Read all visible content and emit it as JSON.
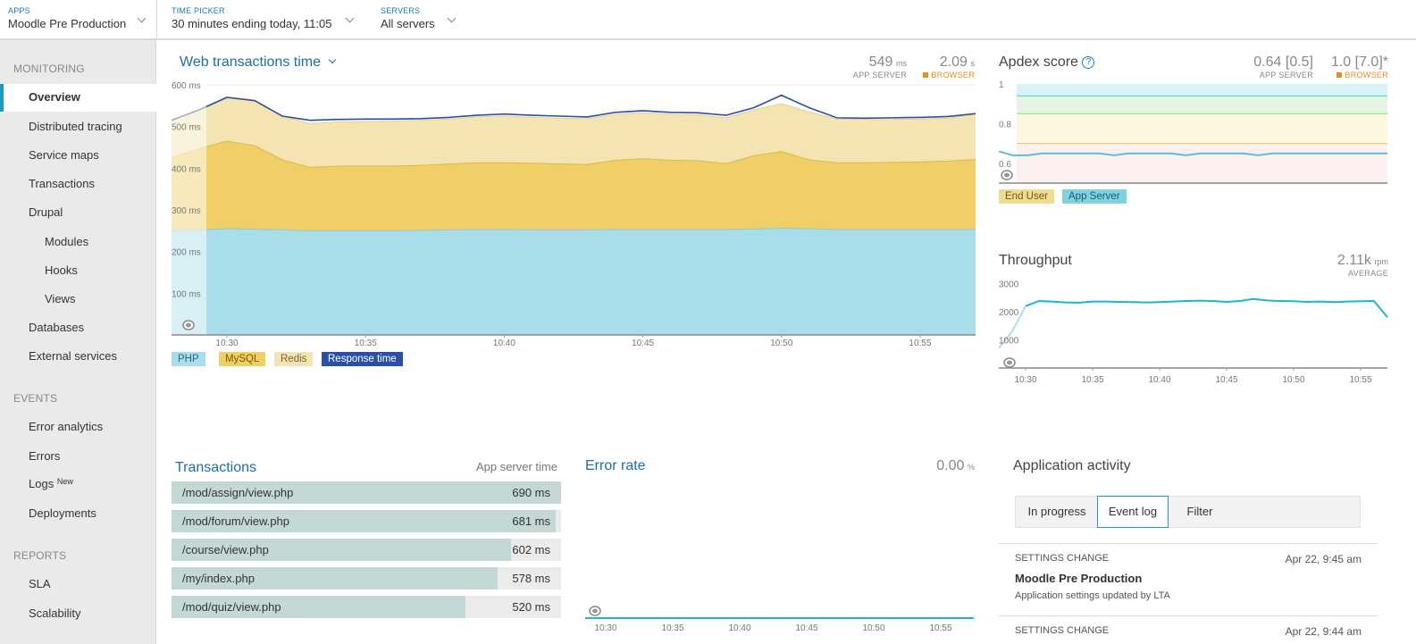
{
  "topbar": {
    "apps": {
      "label": "APPS",
      "value": "Moodle Pre Production"
    },
    "time_picker": {
      "label": "TIME PICKER",
      "value": "30 minutes ending today, 11:05"
    },
    "servers": {
      "label": "SERVERS",
      "value": "All servers"
    }
  },
  "sidebar": {
    "monitoring_header": "MONITORING",
    "overview": "Overview",
    "distributed_tracing": "Distributed tracing",
    "service_maps": "Service maps",
    "transactions": "Transactions",
    "drupal": "Drupal",
    "modules": "Modules",
    "hooks": "Hooks",
    "views": "Views",
    "databases": "Databases",
    "external_services": "External services",
    "events_header": "EVENTS",
    "error_analytics": "Error analytics",
    "errors": "Errors",
    "logs": "Logs",
    "logs_badge": "New",
    "deployments": "Deployments",
    "reports_header": "REPORTS",
    "sla": "SLA",
    "scalability": "Scalability"
  },
  "web_transactions": {
    "title": "Web transactions time",
    "app_server_value": "549",
    "app_server_unit": "ms",
    "app_server_label": "APP SERVER",
    "browser_value": "2.09",
    "browser_unit": "s",
    "browser_label": "BROWSER",
    "y_ticks": [
      "600 ms",
      "500 ms",
      "400 ms",
      "300 ms",
      "200 ms",
      "100 ms"
    ],
    "x_ticks": [
      "10:30",
      "10:35",
      "10:40",
      "10:45",
      "10:50",
      "10:55"
    ],
    "legend": {
      "php": "PHP",
      "mysql": "MySQL",
      "redis": "Redis",
      "response": "Response time"
    }
  },
  "apdex": {
    "title": "Apdex score",
    "app_value": "0.64 [0.5]",
    "app_label": "APP SERVER",
    "browser_value": "1.0 [7.0]*",
    "browser_label": "BROWSER",
    "y_ticks": [
      "1",
      "0.8",
      "0.6"
    ],
    "legend": {
      "end_user": "End User",
      "app_server": "App Server"
    }
  },
  "throughput": {
    "title": "Throughput",
    "value": "2.11k",
    "unit": "rpm",
    "label": "AVERAGE",
    "y_ticks": [
      "3000",
      "2000",
      "1000"
    ],
    "x_ticks": [
      "10:30",
      "10:35",
      "10:40",
      "10:45",
      "10:50",
      "10:55"
    ]
  },
  "transactions_panel": {
    "title": "Transactions",
    "subtitle": "App server time",
    "rows": [
      {
        "name": "/mod/assign/view.php",
        "value": "690 ms",
        "fraction": 1.0
      },
      {
        "name": "/mod/forum/view.php",
        "value": "681 ms",
        "fraction": 0.987
      },
      {
        "name": "/course/view.php",
        "value": "602 ms",
        "fraction": 0.872
      },
      {
        "name": "/my/index.php",
        "value": "578 ms",
        "fraction": 0.838
      },
      {
        "name": "/mod/quiz/view.php",
        "value": "520 ms",
        "fraction": 0.754
      }
    ]
  },
  "error_rate": {
    "title": "Error rate",
    "value": "0.00",
    "unit": "%",
    "x_ticks": [
      "10:30",
      "10:35",
      "10:40",
      "10:45",
      "10:50",
      "10:55"
    ]
  },
  "activity": {
    "title": "Application activity",
    "tabs": [
      "In progress",
      "Event log",
      "Filter"
    ],
    "events": [
      {
        "type": "SETTINGS CHANGE",
        "date": "Apr 22, 9:45 am",
        "title": "Moodle Pre Production",
        "desc": "Application settings updated by LTA"
      },
      {
        "type": "SETTINGS CHANGE",
        "date": "Apr 22, 9:44 am"
      }
    ]
  },
  "colors": {
    "php": "#a9dde9",
    "mysql": "#f0cf67",
    "redis": "#f3e4b2",
    "response": "#2b4fa3",
    "accent": "#1d9cb3",
    "link": "#1a6fa8",
    "browser_orange": "#ef8c1c"
  },
  "chart_data": [
    {
      "type": "area",
      "title": "Web transactions time",
      "x": [
        "10:28",
        "10:29",
        "10:30",
        "10:31",
        "10:32",
        "10:33",
        "10:34",
        "10:35",
        "10:36",
        "10:37",
        "10:38",
        "10:39",
        "10:40",
        "10:41",
        "10:42",
        "10:43",
        "10:44",
        "10:45",
        "10:46",
        "10:47",
        "10:48",
        "10:49",
        "10:50",
        "10:51",
        "10:52",
        "10:53",
        "10:54",
        "10:55",
        "10:56",
        "10:57"
      ],
      "ylim": [
        0,
        600
      ],
      "stacked": true,
      "series": [
        {
          "name": "PHP",
          "values": [
            250,
            252,
            255,
            254,
            252,
            250,
            250,
            250,
            250,
            251,
            252,
            253,
            253,
            252,
            252,
            252,
            253,
            253,
            253,
            253,
            253,
            254,
            256,
            255,
            253,
            253,
            253,
            253,
            253,
            253
          ]
        },
        {
          "name": "MySQL",
          "values": [
            175,
            195,
            210,
            200,
            168,
            152,
            155,
            155,
            155,
            156,
            158,
            160,
            160,
            160,
            158,
            157,
            166,
            170,
            166,
            165,
            158,
            176,
            184,
            165,
            160,
            160,
            161,
            162,
            164,
            168
          ]
        },
        {
          "name": "Redis",
          "values": [
            90,
            95,
            105,
            110,
            105,
            105,
            106,
            107,
            108,
            108,
            108,
            110,
            112,
            110,
            110,
            110,
            110,
            110,
            110,
            110,
            110,
            110,
            115,
            115,
            105,
            104,
            103,
            103,
            103,
            109
          ]
        },
        {
          "name": "Response time",
          "values": [
            515,
            540,
            570,
            562,
            525,
            515,
            517,
            518,
            518,
            519,
            522,
            527,
            530,
            527,
            525,
            523,
            534,
            538,
            534,
            533,
            527,
            545,
            575,
            545,
            521,
            520,
            521,
            522,
            524,
            531
          ]
        }
      ]
    },
    {
      "type": "line",
      "title": "Apdex score",
      "ylim": [
        0.5,
        1.0
      ],
      "series": [
        {
          "name": "App Server",
          "values": [
            0.66,
            0.64,
            0.64,
            0.65,
            0.65,
            0.65,
            0.65,
            0.65,
            0.64,
            0.65,
            0.65,
            0.65,
            0.65,
            0.64,
            0.65,
            0.65,
            0.65,
            0.65,
            0.64,
            0.65,
            0.65,
            0.65,
            0.65,
            0.65,
            0.65,
            0.65,
            0.65,
            0.65
          ]
        }
      ]
    },
    {
      "type": "line",
      "title": "Throughput",
      "x": [
        "10:28",
        "10:29",
        "10:30",
        "10:31",
        "10:32",
        "10:33",
        "10:34",
        "10:35",
        "10:36",
        "10:37",
        "10:38",
        "10:39",
        "10:40",
        "10:41",
        "10:42",
        "10:43",
        "10:44",
        "10:45",
        "10:46",
        "10:47",
        "10:48",
        "10:49",
        "10:50",
        "10:51",
        "10:52",
        "10:53",
        "10:54",
        "10:55",
        "10:56",
        "10:57"
      ],
      "ylim": [
        0,
        3300
      ],
      "series": [
        {
          "name": "",
          "values": [
            700,
            1300,
            2200,
            2380,
            2360,
            2330,
            2320,
            2360,
            2360,
            2350,
            2340,
            2330,
            2340,
            2360,
            2380,
            2390,
            2380,
            2350,
            2380,
            2450,
            2400,
            2380,
            2370,
            2350,
            2360,
            2340,
            2360,
            2370,
            2380,
            1800
          ]
        }
      ]
    },
    {
      "type": "line",
      "title": "Error rate",
      "series": [
        {
          "name": "",
          "values": [
            0,
            0,
            0,
            0,
            0,
            0,
            0,
            0,
            0,
            0,
            0,
            0,
            0,
            0,
            0,
            0,
            0,
            0,
            0,
            0,
            0,
            0,
            0,
            0,
            0,
            0,
            0,
            0,
            0,
            0
          ]
        }
      ]
    }
  ]
}
